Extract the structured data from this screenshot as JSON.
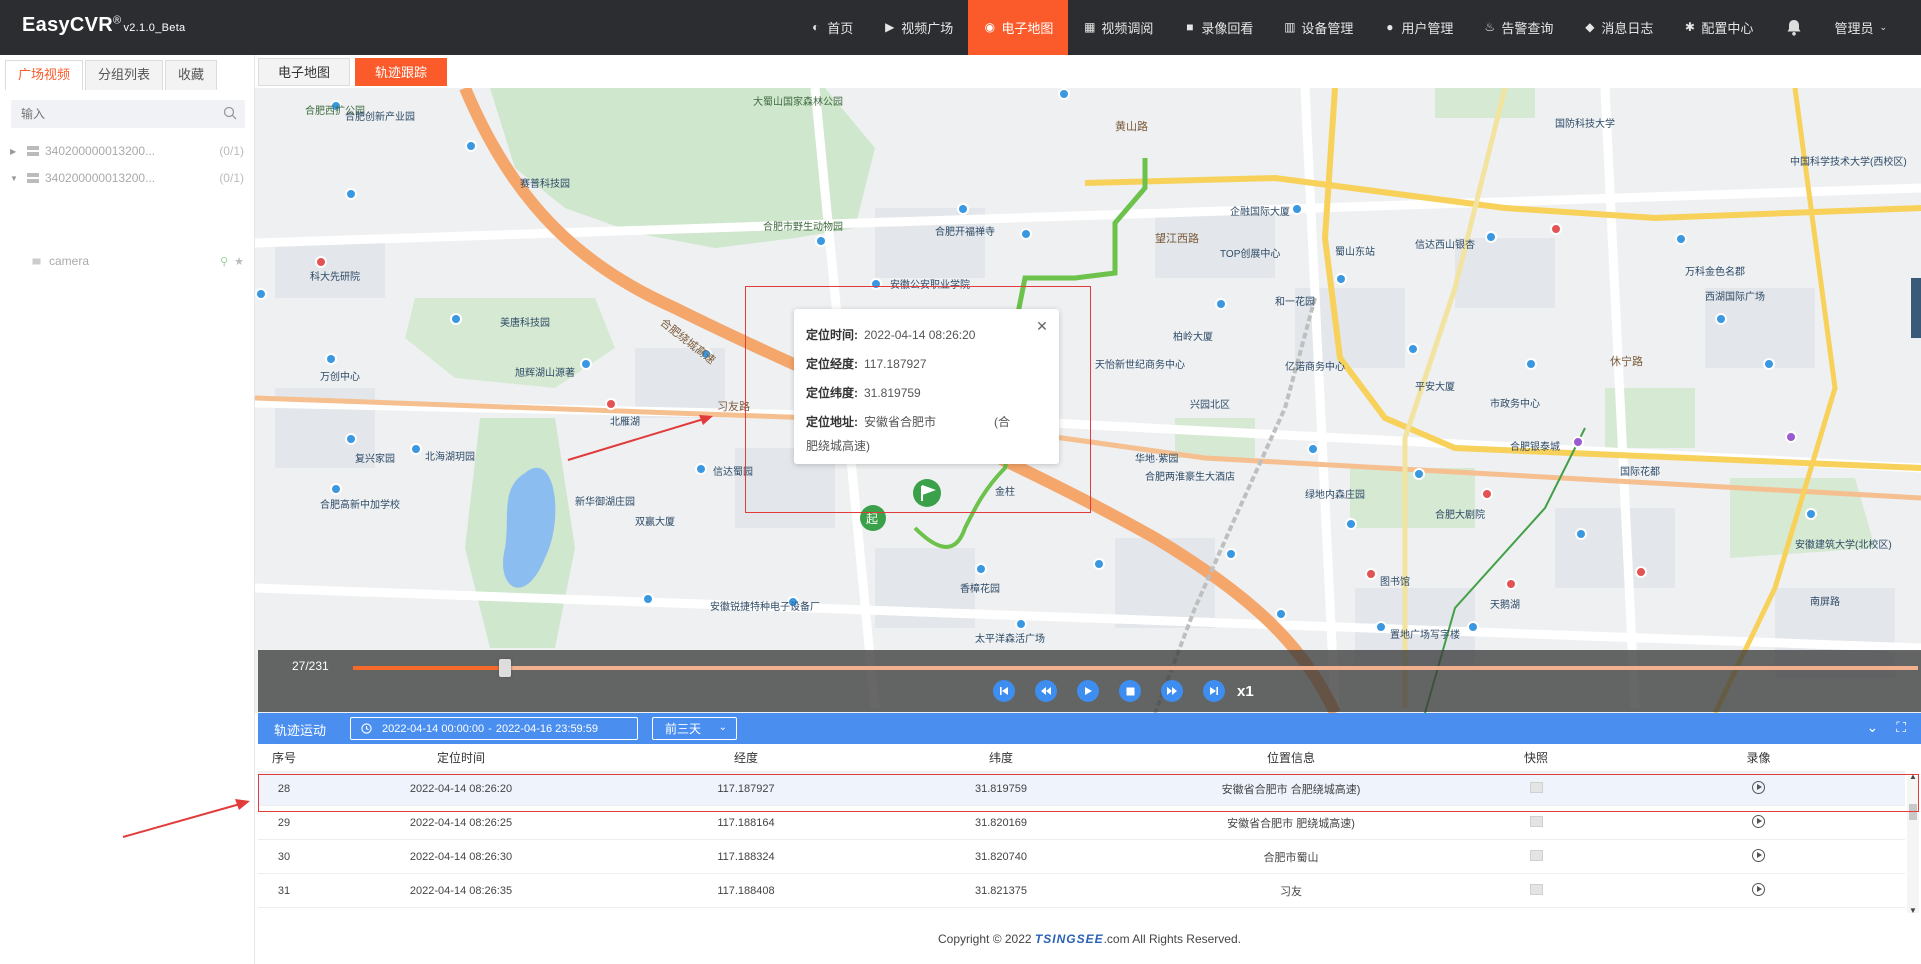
{
  "app": {
    "brand": "EasyCVR",
    "brand_mark": "®",
    "version": "v2.1.0_Beta"
  },
  "nav": [
    {
      "label": "首页",
      "icon": "dashboard-icon"
    },
    {
      "label": "视频广场",
      "icon": "play-circle-icon"
    },
    {
      "label": "电子地图",
      "icon": "map-pin-icon",
      "active": true
    },
    {
      "label": "视频调阅",
      "icon": "grid-icon"
    },
    {
      "label": "录像回看",
      "icon": "camera-icon"
    },
    {
      "label": "设备管理",
      "icon": "device-icon"
    },
    {
      "label": "用户管理",
      "icon": "user-icon"
    },
    {
      "label": "告警查询",
      "icon": "alarm-icon"
    },
    {
      "label": "消息日志",
      "icon": "bell-icon"
    },
    {
      "label": "配置中心",
      "icon": "gear-icon"
    }
  ],
  "user": {
    "label": "管理员"
  },
  "left": {
    "tabs": [
      "广场视频",
      "分组列表",
      "收藏"
    ],
    "active_tab": 0,
    "search_placeholder": "输入",
    "tree": [
      {
        "label": "340200000013200...",
        "count": "(0/1)",
        "expanded": false
      },
      {
        "label": "340200000013200...",
        "count": "(0/1)",
        "expanded": true
      }
    ],
    "camera": "camera"
  },
  "main_tabs": [
    "电子地图",
    "轨迹跟踪"
  ],
  "main_active_tab": 1,
  "popup": {
    "rows": [
      {
        "k": "定位时间:",
        "v": "2022-04-14 08:26:20"
      },
      {
        "k": "定位经度:",
        "v": "117.187927"
      },
      {
        "k": "定位纬度:",
        "v": "31.819759"
      },
      {
        "k": "定位地址:",
        "v": "安徽省合肥市"
      }
    ],
    "address_tail": "(合",
    "address_line2": "肥绕城高速)"
  },
  "player": {
    "counter": "27/231",
    "progress": 0.097,
    "speed": "x1"
  },
  "track": {
    "title": "轨迹运动",
    "date_start": "2022-04-14 00:00:00",
    "date_sep": "-",
    "date_end": "2022-04-16 23:59:59",
    "preset": "前三天"
  },
  "table": {
    "headers": [
      "序号",
      "定位时间",
      "经度",
      "纬度",
      "位置信息",
      "快照",
      "录像"
    ],
    "rows": [
      {
        "no": "28",
        "time": "2022-04-14 08:26:20",
        "lng": "117.187927",
        "lat": "31.819759",
        "addr": "安徽省合肥市    合肥绕城高速)"
      },
      {
        "no": "29",
        "time": "2022-04-14 08:26:25",
        "lng": "117.188164",
        "lat": "31.820169",
        "addr": "安徽省合肥市    肥绕城高速)"
      },
      {
        "no": "30",
        "time": "2022-04-14 08:26:30",
        "lng": "117.188324",
        "lat": "31.820740",
        "addr": "合肥市蜀山"
      },
      {
        "no": "31",
        "time": "2022-04-14 08:26:35",
        "lng": "117.188408",
        "lat": "31.821375",
        "addr": "习友"
      }
    ]
  },
  "footer": {
    "pre": "Copyright © 2022 ",
    "brand": "TSINGSEE",
    "post": ".com All Rights Reserved."
  },
  "map": {
    "labels": [
      {
        "t": "大蜀山国家森林公园",
        "g": true
      },
      {
        "t": "合肥西扩公园",
        "g": true
      },
      {
        "t": "合肥创新产业园"
      },
      {
        "t": "合肥市野生动物园",
        "g": true
      },
      {
        "t": "安徽公安职业学院"
      },
      {
        "t": "合肥开福禅寺"
      },
      {
        "t": "黄山路",
        "road": true
      },
      {
        "t": "望江西路",
        "road": true
      },
      {
        "t": "合肥绕城高速",
        "road": true
      },
      {
        "t": "习友路",
        "road": true
      },
      {
        "t": "TOP创展中心"
      },
      {
        "t": "企融国际大厦"
      },
      {
        "t": "蜀山东站"
      },
      {
        "t": "信达西山银杏"
      },
      {
        "t": "合肥高新中加学校"
      },
      {
        "t": "旭辉湖山源著"
      },
      {
        "t": "新华御湖庄园"
      },
      {
        "t": "双赢大厦"
      },
      {
        "t": "安徽锐捷特种电子设备厂"
      },
      {
        "t": "香樟花园"
      },
      {
        "t": "太平洋森活广场"
      },
      {
        "t": "合肥两淮豪生大酒店"
      },
      {
        "t": "绿地内森庄园"
      },
      {
        "t": "合肥大剧院"
      },
      {
        "t": "图书馆"
      },
      {
        "t": "天鹅湖"
      },
      {
        "t": "置地广场写字楼"
      },
      {
        "t": "西湖国际广场"
      },
      {
        "t": "国防科技大学"
      },
      {
        "t": "中国科学技术大学(西校区)"
      },
      {
        "t": "万科金色名郡"
      },
      {
        "t": "休宁路",
        "road": true
      },
      {
        "t": "市政务中心"
      },
      {
        "t": "合肥银泰城"
      },
      {
        "t": "国际花都"
      },
      {
        "t": "安徽建筑大学(北校区)"
      },
      {
        "t": "金柱"
      },
      {
        "t": "兴园北区"
      },
      {
        "t": "亿诺商务中心"
      },
      {
        "t": "平安大厦"
      },
      {
        "t": "华地·紫园"
      },
      {
        "t": "天怡新世纪商务中心"
      },
      {
        "t": "柏岭大厦"
      },
      {
        "t": "和一花园"
      },
      {
        "t": "科大先研院"
      },
      {
        "t": "赛普科技园"
      },
      {
        "t": "万创中心"
      },
      {
        "t": "复兴家园"
      },
      {
        "t": "北海湖玥园"
      },
      {
        "t": "美唐科技园"
      },
      {
        "t": "北雁湖"
      },
      {
        "t": "信达蜀园"
      },
      {
        "t": "南屏路"
      }
    ]
  }
}
